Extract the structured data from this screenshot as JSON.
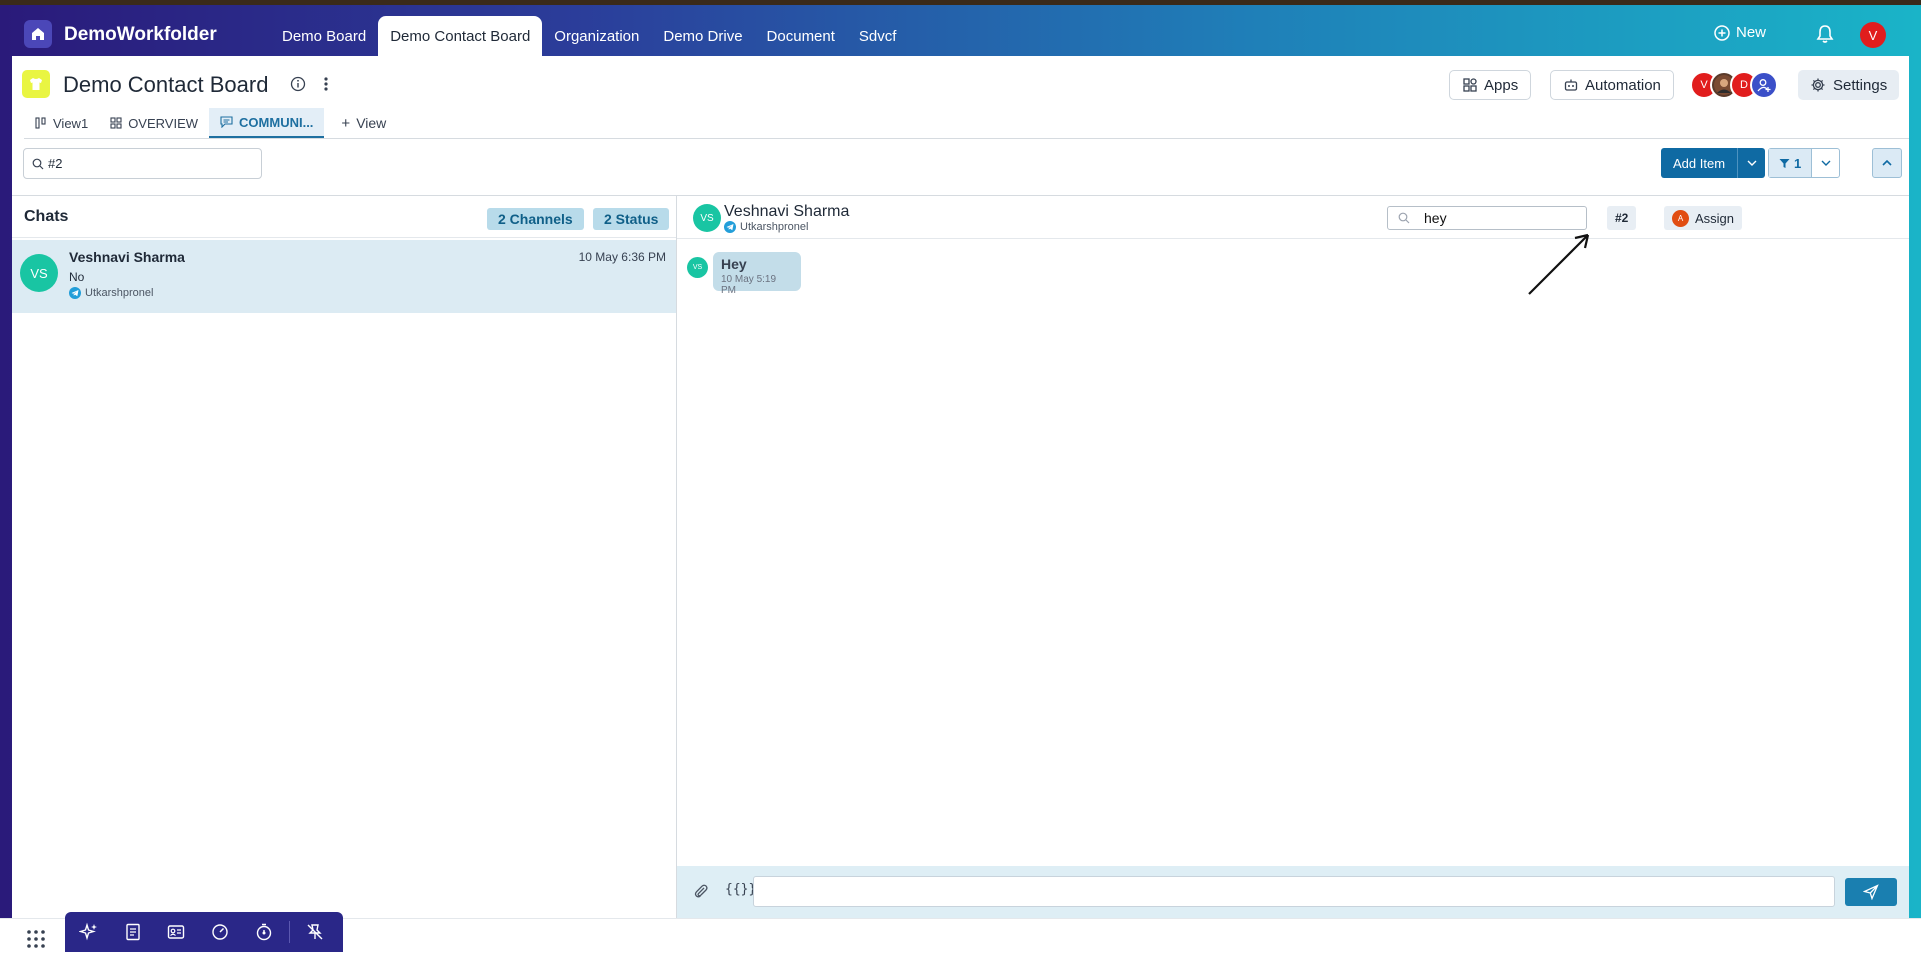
{
  "app": {
    "brand": "DemoWorkfolder",
    "nav_tabs": [
      "Demo Board",
      "Demo Contact Board",
      "Organization",
      "Demo Drive",
      "Document",
      "Sdvcf"
    ],
    "new_label": "New",
    "user_initial": "V"
  },
  "board": {
    "title": "Demo Contact Board",
    "apps_label": "Apps",
    "automation_label": "Automation",
    "settings_label": "Settings",
    "members": [
      "V",
      "",
      "D"
    ],
    "view_tabs": [
      "View1",
      "OVERVIEW",
      "COMMUNI..."
    ],
    "add_view_label": "View",
    "search_value": "#2",
    "add_item_label": "Add Item",
    "filter_count": "1"
  },
  "chats": {
    "header": "Chats",
    "channels_label": "2 Channels",
    "status_label": "2 Status",
    "items": [
      {
        "initials": "VS",
        "name": "Veshnavi Sharma",
        "message": "No",
        "source": "Utkarshpronel",
        "time": "10 May 6:36 PM"
      }
    ]
  },
  "conversation": {
    "initials": "VS",
    "name": "Veshnavi Sharma",
    "source": "Utkarshpronel",
    "search_value": "hey",
    "tag": "#2",
    "assign_initial": "A",
    "assign_label": "Assign",
    "messages": [
      {
        "initials": "VS",
        "text": "Hey",
        "time": "10 May 5:19 PM"
      }
    ],
    "braces_label": "{{}}"
  },
  "colors": {
    "accent": "#0f6aa3",
    "avatar_teal": "#19c5a3",
    "selected_row": "#dcebf3",
    "dock": "#2a2788"
  }
}
